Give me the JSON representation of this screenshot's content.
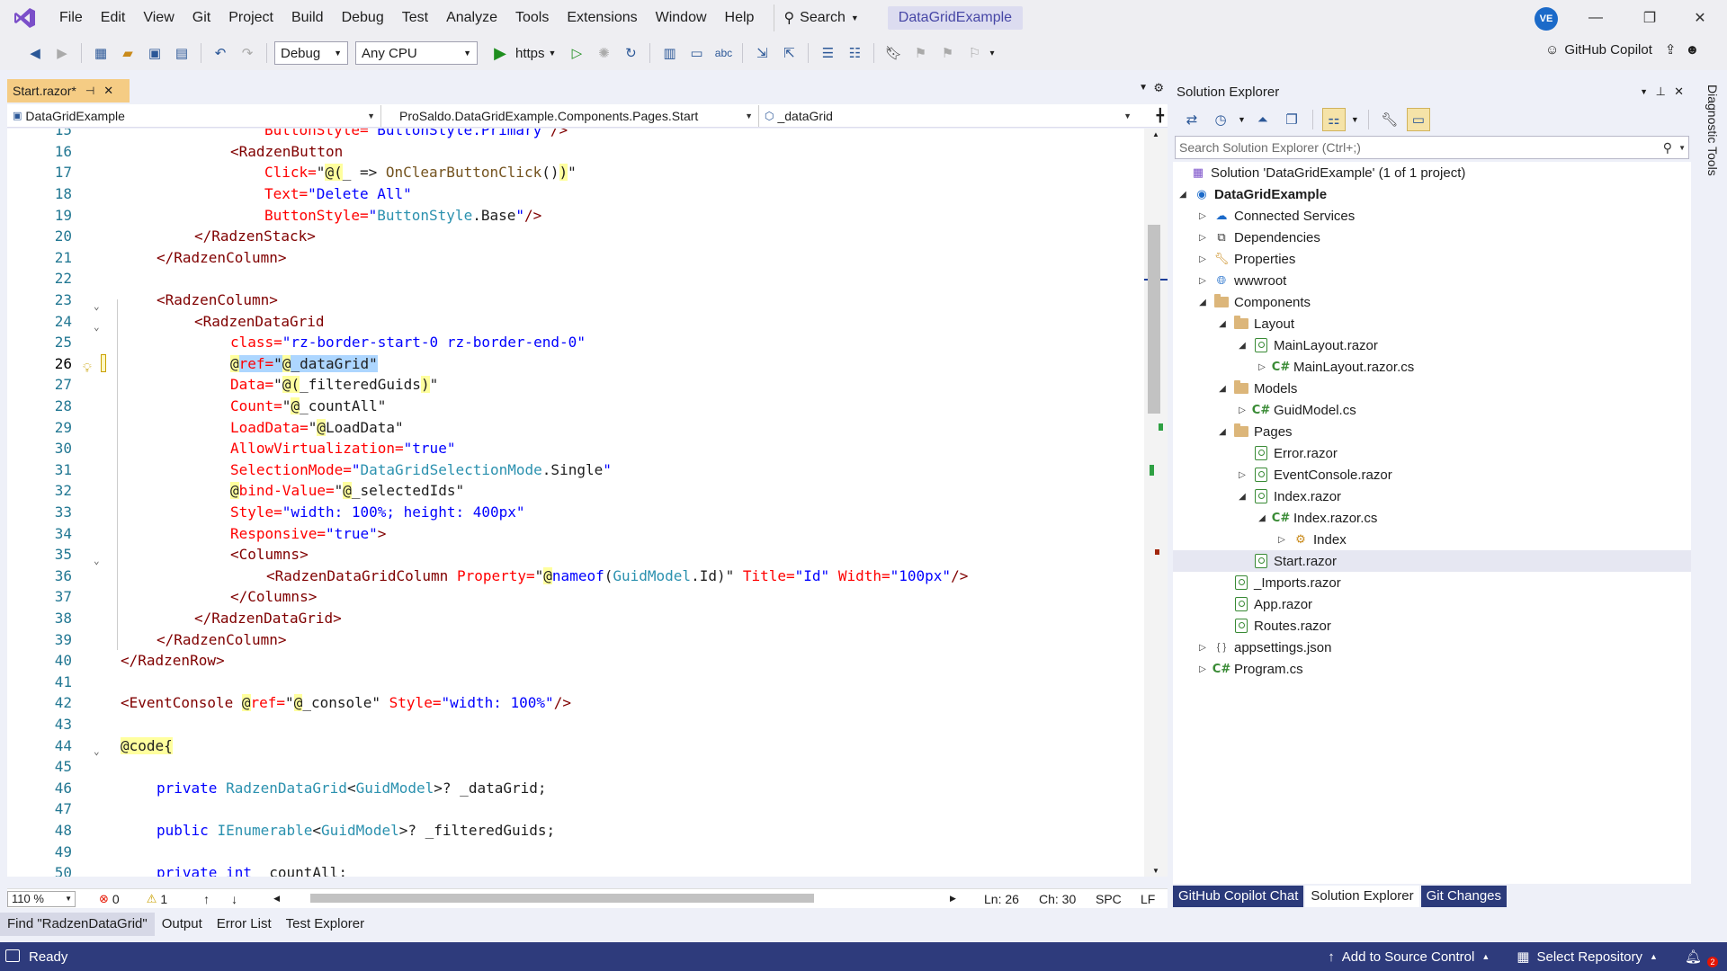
{
  "menu": {
    "items": [
      "File",
      "Edit",
      "View",
      "Git",
      "Project",
      "Build",
      "Debug",
      "Test",
      "Analyze",
      "Tools",
      "Extensions",
      "Window",
      "Help"
    ],
    "search_label": "Search",
    "solution_name": "DataGridExample",
    "avatar_initials": "VE"
  },
  "toolbar": {
    "config": "Debug",
    "platform": "Any CPU",
    "run_label": "https",
    "copilot_label": "GitHub Copilot"
  },
  "editor": {
    "tab_title": "Start.razor*",
    "nav_project": "DataGridExample",
    "nav_class": "ProSaldo.DataGridExample.Components.Pages.Start",
    "nav_member": "_dataGrid",
    "zoom": "110 %",
    "errors": "0",
    "warnings": "1",
    "line": "Ln: 26",
    "col": "Ch: 30",
    "spacing": "SPC",
    "eol": "LF"
  },
  "code_lines": [
    {
      "n": "15",
      "text": "ButtonStyle=\"ButtonStyle.Primary\"/>"
    },
    {
      "n": "16",
      "text": "<RadzenButton"
    },
    {
      "n": "17",
      "text": "Click=\"@(_ => OnClearButtonClick())\""
    },
    {
      "n": "18",
      "text": "Text=\"Delete All\""
    },
    {
      "n": "19",
      "text": "ButtonStyle=\"ButtonStyle.Base\"/>"
    },
    {
      "n": "20",
      "text": "</RadzenStack>"
    },
    {
      "n": "21",
      "text": "</RadzenColumn>"
    },
    {
      "n": "22",
      "text": ""
    },
    {
      "n": "23",
      "text": "<RadzenColumn>"
    },
    {
      "n": "24",
      "text": "<RadzenDataGrid"
    },
    {
      "n": "25",
      "text": "class=\"rz-border-start-0 rz-border-end-0\""
    },
    {
      "n": "26",
      "text": "@ref=\"@_dataGrid\""
    },
    {
      "n": "27",
      "text": "Data=\"@(_filteredGuids)\""
    },
    {
      "n": "28",
      "text": "Count=\"@_countAll\""
    },
    {
      "n": "29",
      "text": "LoadData=\"@LoadData\""
    },
    {
      "n": "30",
      "text": "AllowVirtualization=\"true\""
    },
    {
      "n": "31",
      "text": "SelectionMode=\"DataGridSelectionMode.Single\""
    },
    {
      "n": "32",
      "text": "@bind-Value=\"@_selectedIds\""
    },
    {
      "n": "33",
      "text": "Style=\"width: 100%; height: 400px\""
    },
    {
      "n": "34",
      "text": "Responsive=\"true\">"
    },
    {
      "n": "35",
      "text": "<Columns>"
    },
    {
      "n": "36",
      "text": "<RadzenDataGridColumn Property=\"@nameof(GuidModel.Id)\" Title=\"Id\" Width=\"100px\"/>"
    },
    {
      "n": "37",
      "text": "</Columns>"
    },
    {
      "n": "38",
      "text": "</RadzenDataGrid>"
    },
    {
      "n": "39",
      "text": "</RadzenColumn>"
    },
    {
      "n": "40",
      "text": "</RadzenRow>"
    },
    {
      "n": "41",
      "text": ""
    },
    {
      "n": "42",
      "text": "<EventConsole @ref=\"@_console\" Style=\"width: 100%\"/>"
    },
    {
      "n": "43",
      "text": ""
    },
    {
      "n": "44",
      "text": "@code{"
    },
    {
      "n": "45",
      "text": ""
    },
    {
      "n": "46",
      "text": "private RadzenDataGrid<GuidModel>? _dataGrid;"
    },
    {
      "n": "47",
      "text": ""
    },
    {
      "n": "48",
      "text": "public IEnumerable<GuidModel>? _filteredGuids;"
    },
    {
      "n": "49",
      "text": ""
    },
    {
      "n": "50",
      "text": "private int _countAll;"
    }
  ],
  "solution_explorer": {
    "title": "Solution Explorer",
    "search_placeholder": "Search Solution Explorer (Ctrl+;)",
    "items": [
      {
        "label": "Solution 'DataGridExample' (1 of 1 project)",
        "icon": "solution-icon"
      },
      {
        "label": "DataGridExample",
        "icon": "project-icon"
      },
      {
        "label": "Connected Services",
        "icon": "connected-services-icon"
      },
      {
        "label": "Dependencies",
        "icon": "dependencies-icon"
      },
      {
        "label": "Properties",
        "icon": "properties-icon"
      },
      {
        "label": "wwwroot",
        "icon": "globe-icon"
      },
      {
        "label": "Components",
        "icon": "folder-icon"
      },
      {
        "label": "Layout",
        "icon": "folder-icon"
      },
      {
        "label": "MainLayout.razor",
        "icon": "razor-file-icon"
      },
      {
        "label": "MainLayout.razor.cs",
        "icon": "csharp-file-icon"
      },
      {
        "label": "Models",
        "icon": "folder-icon"
      },
      {
        "label": "GuidModel.cs",
        "icon": "csharp-file-icon"
      },
      {
        "label": "Pages",
        "icon": "folder-icon"
      },
      {
        "label": "Error.razor",
        "icon": "razor-file-icon"
      },
      {
        "label": "EventConsole.razor",
        "icon": "razor-file-icon"
      },
      {
        "label": "Index.razor",
        "icon": "razor-file-icon"
      },
      {
        "label": "Index.razor.cs",
        "icon": "csharp-file-icon"
      },
      {
        "label": "Index",
        "icon": "class-icon"
      },
      {
        "label": "Start.razor",
        "icon": "razor-file-icon"
      },
      {
        "label": "_Imports.razor",
        "icon": "razor-file-icon"
      },
      {
        "label": "App.razor",
        "icon": "razor-file-icon"
      },
      {
        "label": "Routes.razor",
        "icon": "razor-file-icon"
      },
      {
        "label": "appsettings.json",
        "icon": "json-file-icon"
      },
      {
        "label": "Program.cs",
        "icon": "csharp-file-icon"
      }
    ],
    "tabs": [
      "GitHub Copilot Chat",
      "Solution Explorer",
      "Git Changes"
    ]
  },
  "side_tab": "Diagnostic Tools",
  "bottom_tabs": [
    "Find \"RadzenDataGrid\"",
    "Output",
    "Error List",
    "Test Explorer"
  ],
  "status": {
    "ready": "Ready",
    "source_control": "Add to Source Control",
    "repository": "Select Repository",
    "notifications": "2"
  }
}
